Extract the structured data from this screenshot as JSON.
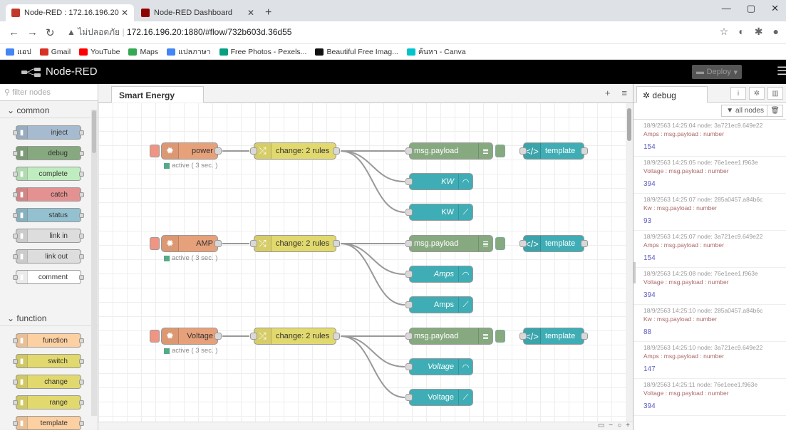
{
  "browser": {
    "tabs": [
      {
        "title": "Node-RED : 172.16.196.20",
        "active": true,
        "color": "#c0392b"
      },
      {
        "title": "Node-RED Dashboard",
        "active": false,
        "color": "#8f0000"
      }
    ],
    "url_security": "ไม่ปลอดภัย",
    "url": "172.16.196.20:1880/#flow/732b603d.36d55",
    "bookmarks": [
      {
        "label": "แอป",
        "color": "#4285f4"
      },
      {
        "label": "Gmail",
        "color": "#d93025"
      },
      {
        "label": "YouTube",
        "color": "#ff0000"
      },
      {
        "label": "Maps",
        "color": "#34a853"
      },
      {
        "label": "แปลภาษา",
        "color": "#4285f4"
      },
      {
        "label": "Free Photos - Pexels...",
        "color": "#05a081"
      },
      {
        "label": "Beautiful Free Imag...",
        "color": "#111111"
      },
      {
        "label": "ค้นหา - Canva",
        "color": "#00c4cc"
      }
    ]
  },
  "app": {
    "title": "Node-RED",
    "deploy_label": "Deploy"
  },
  "palette": {
    "filter_placeholder": "filter nodes",
    "categories": [
      {
        "name": "common",
        "nodes": [
          {
            "label": "inject",
            "color": "#a6bbcf"
          },
          {
            "label": "debug",
            "color": "#87a980"
          },
          {
            "label": "complete",
            "color": "#c0edc0"
          },
          {
            "label": "catch",
            "color": "#e49191"
          },
          {
            "label": "status",
            "color": "#94c1d0"
          },
          {
            "label": "link in",
            "color": "#dddddd"
          },
          {
            "label": "link out",
            "color": "#dddddd"
          },
          {
            "label": "comment",
            "color": "#ffffff"
          }
        ]
      },
      {
        "name": "function",
        "nodes": [
          {
            "label": "function",
            "color": "#fdd0a2"
          },
          {
            "label": "switch",
            "color": "#e2d96e"
          },
          {
            "label": "change",
            "color": "#e2d96e"
          },
          {
            "label": "range",
            "color": "#e2d96e"
          },
          {
            "label": "template",
            "color": "#fdd0a2"
          }
        ]
      }
    ]
  },
  "workspace": {
    "tab": "Smart Energy",
    "rows": [
      {
        "input": "power",
        "status": "active ( 3 sec. )",
        "change": "change: 2 rules",
        "debug": "msg.payload",
        "gauge": "KW",
        "chart": "KW",
        "template": "template"
      },
      {
        "input": "AMP",
        "status": "active ( 3 sec. )",
        "change": "change: 2 rules",
        "debug": "msg.payload",
        "gauge": "Amps",
        "chart": "Amps",
        "template": "template"
      },
      {
        "input": "Voltage",
        "status": "active ( 3 sec. )",
        "change": "change: 2 rules",
        "debug": "msg.payload",
        "gauge": "Voltage",
        "chart": "Voltage",
        "template": "template"
      }
    ]
  },
  "sidebar": {
    "tab": "debug",
    "filter": "all nodes",
    "messages": [
      {
        "meta": "18/9/2563 14:25:04  node: 3a721ec9.649e22",
        "topic": "Amps : msg.payload : number",
        "value": "154"
      },
      {
        "meta": "18/9/2563 14:25:05  node: 76e1eee1.f963e",
        "topic": "Voltage : msg.payload : number",
        "value": "394"
      },
      {
        "meta": "18/9/2563 14:25:07  node: 285a0457.a84b6c",
        "topic": "Kw : msg.payload : number",
        "value": "93"
      },
      {
        "meta": "18/9/2563 14:25:07  node: 3a721ec9.649e22",
        "topic": "Amps : msg.payload : number",
        "value": "154"
      },
      {
        "meta": "18/9/2563 14:25:08  node: 76e1eee1.f963e",
        "topic": "Voltage : msg.payload : number",
        "value": "394"
      },
      {
        "meta": "18/9/2563 14:25:10  node: 285a0457.a84b6c",
        "topic": "Kw : msg.payload : number",
        "value": "88"
      },
      {
        "meta": "18/9/2563 14:25:10  node: 3a721ec9.649e22",
        "topic": "Amps : msg.payload : number",
        "value": "147"
      },
      {
        "meta": "18/9/2563 14:25:11  node: 76e1eee1.f963e",
        "topic": "Voltage : msg.payload : number",
        "value": "394"
      }
    ]
  },
  "colors": {
    "inject": "#e7a17a",
    "change": "#e2d96e",
    "debug": "#87a980",
    "dashboard": "#3fadb5",
    "template": "#3fadb5"
  }
}
